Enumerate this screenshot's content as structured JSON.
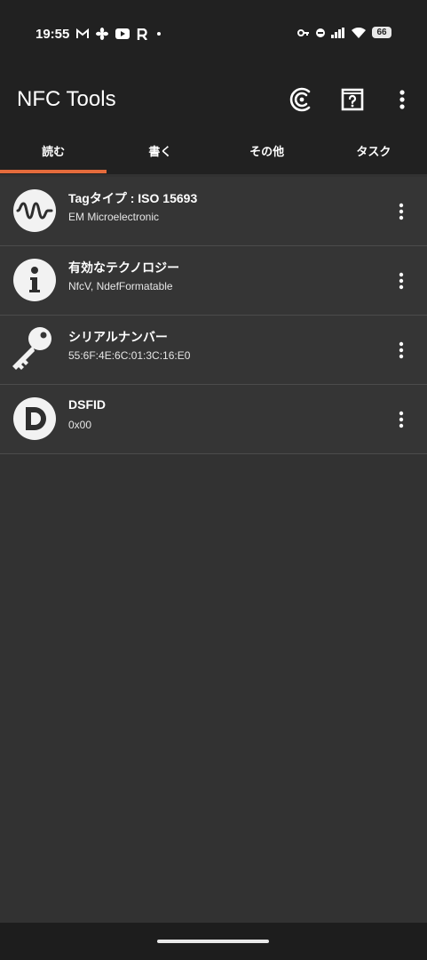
{
  "status": {
    "time": "19:55",
    "battery": "66"
  },
  "appbar": {
    "title": "NFC Tools"
  },
  "tabs": [
    {
      "label": "読む"
    },
    {
      "label": "書く"
    },
    {
      "label": "その他"
    },
    {
      "label": "タスク"
    }
  ],
  "items": [
    {
      "title": "Tagタイプ : ISO 15693",
      "subtitle": "EM Microelectronic",
      "icon": "wave-icon"
    },
    {
      "title": "有効なテクノロジー",
      "subtitle": "NfcV, NdefFormatable",
      "icon": "info-icon"
    },
    {
      "title": "シリアルナンバー",
      "subtitle": "55:6F:4E:6C:01:3C:16:E0",
      "icon": "key-icon"
    },
    {
      "title": "DSFID",
      "subtitle": "0x00",
      "icon": "letter-d-icon"
    }
  ],
  "colors": {
    "accent": "#e46b3c",
    "appbar": "#212121",
    "background": "#323232"
  }
}
